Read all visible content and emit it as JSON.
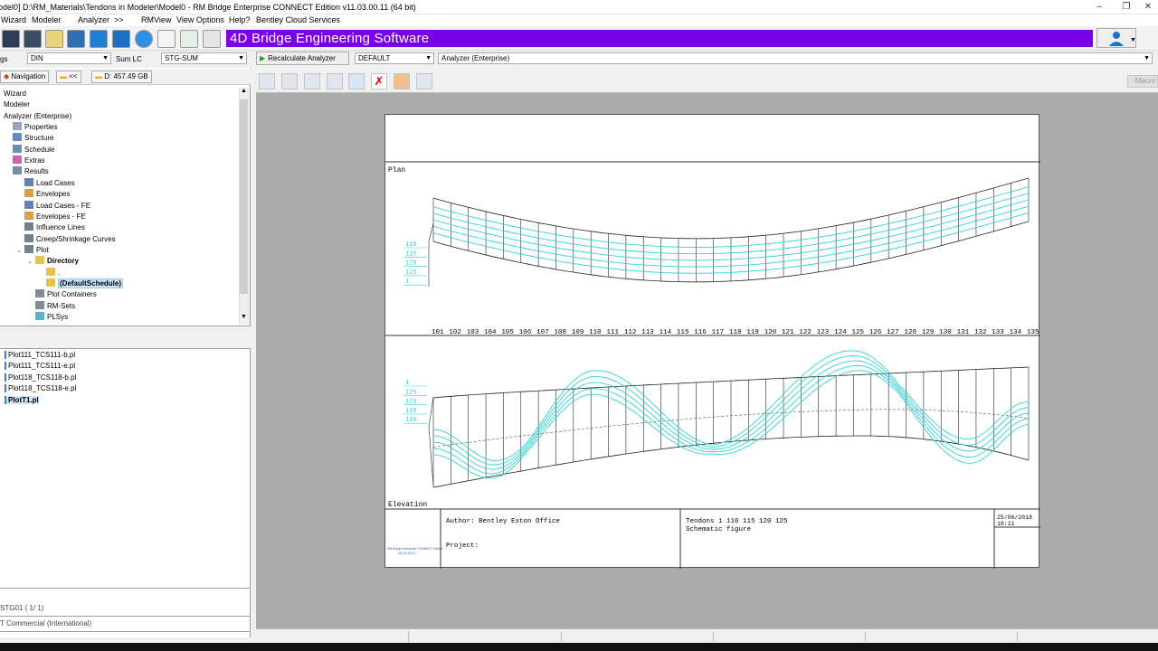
{
  "window": {
    "title": "odel0] D:\\RM_Materials\\Tendons in Modeler\\Model0 - RM Bridge Enterprise CONNECT Edition v11.03.00.11 (64 bit)",
    "minimize": "–",
    "restore": "❐",
    "close": "✕"
  },
  "menu": [
    "Wizard",
    "Modeler",
    "Analyzer",
    ">>",
    "RMView",
    "View Options",
    "Help?",
    "Bentley Cloud Services"
  ],
  "banner": "4D Bridge Engineering Software",
  "row2": {
    "left_label": "gs",
    "norm_value": "DIN",
    "sum_label": "Sum LC",
    "sum_value": "STG-SUM",
    "recalc_label": "Recalculate Analyzer",
    "default_value": "DEFAULT",
    "analyzer_value": "Analyzer (Enterprise)"
  },
  "nav": {
    "tab": "Navigation",
    "back": "<<",
    "disk": "D: 457.49 GB"
  },
  "tree": [
    {
      "label": "Wizard",
      "level": 0
    },
    {
      "label": "Modeler",
      "level": 0
    },
    {
      "label": "Analyzer (Enterprise)",
      "level": 0
    },
    {
      "label": "Properties",
      "level": 1
    },
    {
      "label": "Structure",
      "level": 1
    },
    {
      "label": "Schedule",
      "level": 1
    },
    {
      "label": "Extras",
      "level": 1
    },
    {
      "label": "Results",
      "level": 1
    },
    {
      "label": "Load Cases",
      "level": 2
    },
    {
      "label": "Envelopes",
      "level": 2
    },
    {
      "label": "Load Cases - FE",
      "level": 2
    },
    {
      "label": "Envelopes - FE",
      "level": 2
    },
    {
      "label": "Influence Lines",
      "level": 2
    },
    {
      "label": "Creep/Shrinkage Curves",
      "level": 2
    },
    {
      "label": "Plot",
      "level": 2
    },
    {
      "label": "Directory",
      "level": 3
    },
    {
      "label": ".",
      "level": 4
    },
    {
      "label": "(DefaultSchedule)",
      "level": 4
    },
    {
      "label": "Plot Containers",
      "level": 3
    },
    {
      "label": "RM-Sets",
      "level": 3
    },
    {
      "label": "PLSys",
      "level": 3
    }
  ],
  "files": [
    "Plot111_TCS111-b.pl",
    "Plot111_TCS111-e.pl",
    "Plot118_TCS118-b.pl",
    "Plot118_TCS118-e.pl",
    "PlotT1.pl"
  ],
  "bottom": {
    "stage": "STG01  ( 1/ 1)",
    "license": "T Commercial (International)"
  },
  "macro": "Macro",
  "drawing": {
    "plan_label": "Plan",
    "elevation_label": "Elevation",
    "plan_tendons": [
      "110",
      "115",
      "120",
      "125",
      "1"
    ],
    "elev_tendons": [
      "1",
      "125",
      "120",
      "115",
      "110"
    ],
    "stations": [
      "101",
      "102",
      "103",
      "104",
      "105",
      "106",
      "107",
      "108",
      "109",
      "110",
      "111",
      "112",
      "113",
      "114",
      "115",
      "116",
      "117",
      "118",
      "119",
      "120",
      "121",
      "122",
      "123",
      "124",
      "125",
      "126",
      "127",
      "128",
      "129",
      "130",
      "131",
      "132",
      "133",
      "134",
      "135"
    ],
    "author": "Author: Bentley Exton Office",
    "project": "Project:",
    "tendons_title": "Tendons  1 110 115 120 125",
    "subtitle": "Schematic figure",
    "date": "25/06/2018",
    "time": "18:11",
    "logo_line1": "RM Bridge Enterprise CONNECT Edition",
    "logo_line2": "v11.03.00.11"
  },
  "colors": {
    "banner": "#7a00e6",
    "tendon": "#32d2d2",
    "selected": "#cce4f7"
  }
}
